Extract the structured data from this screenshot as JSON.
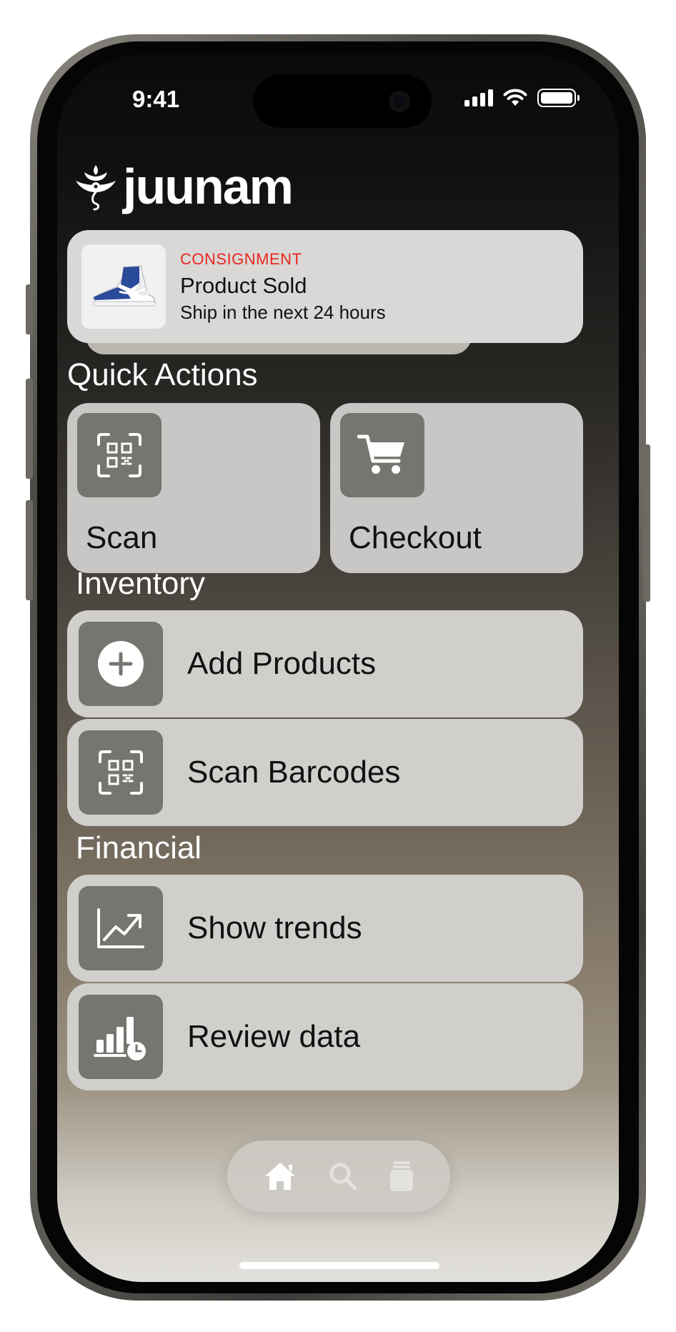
{
  "status_bar": {
    "time": "9:41"
  },
  "brand": {
    "name": "juunam"
  },
  "notification": {
    "tag": "CONSIGNMENT",
    "title": "Product Sold",
    "subtitle": "Ship in the next 24 hours",
    "thumbnail_icon": "sneaker-image",
    "tag_color": "#e8281e"
  },
  "quick_actions": {
    "title": "Quick Actions",
    "items": [
      {
        "label": "Scan",
        "icon": "qr-scan-icon"
      },
      {
        "label": "Checkout",
        "icon": "cart-icon"
      }
    ]
  },
  "inventory": {
    "title": "Inventory",
    "items": [
      {
        "label": "Add Products",
        "icon": "plus-circle-icon"
      },
      {
        "label": "Scan Barcodes",
        "icon": "qr-scan-icon"
      }
    ]
  },
  "financial": {
    "title": "Financial",
    "items": [
      {
        "label": "Show trends",
        "icon": "trend-chart-icon"
      },
      {
        "label": "Review data",
        "icon": "bar-chart-clock-icon"
      }
    ]
  },
  "tab_bar": {
    "items": [
      {
        "icon": "home-icon",
        "active": true
      },
      {
        "icon": "search-icon",
        "active": false
      },
      {
        "icon": "jar-icon",
        "active": false
      }
    ]
  }
}
